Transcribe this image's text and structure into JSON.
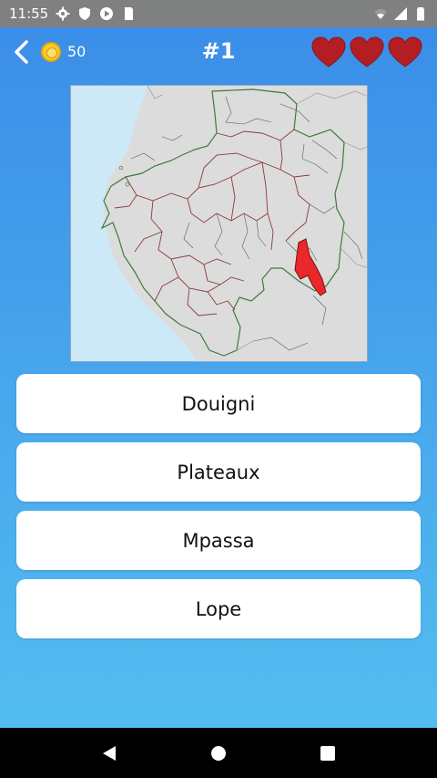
{
  "status_bar": {
    "time": "11:55",
    "left_icons": [
      "gear-icon",
      "shield-icon",
      "play-icon",
      "sd-card-icon"
    ],
    "right_icons": [
      "wifi-icon",
      "signal-icon",
      "battery-icon"
    ]
  },
  "header": {
    "coins": "50",
    "question_number": "#1",
    "lives": 3,
    "heart_color": "#b21e24"
  },
  "map": {
    "highlight_color": "#e8282a",
    "sea_color": "#cde9f8",
    "land_color": "#dcdcdc"
  },
  "answers": [
    {
      "label": "Douigni"
    },
    {
      "label": "Plateaux"
    },
    {
      "label": "Mpassa"
    },
    {
      "label": "Lope"
    }
  ],
  "navigation": [
    "back-icon",
    "home-icon",
    "recents-icon"
  ]
}
